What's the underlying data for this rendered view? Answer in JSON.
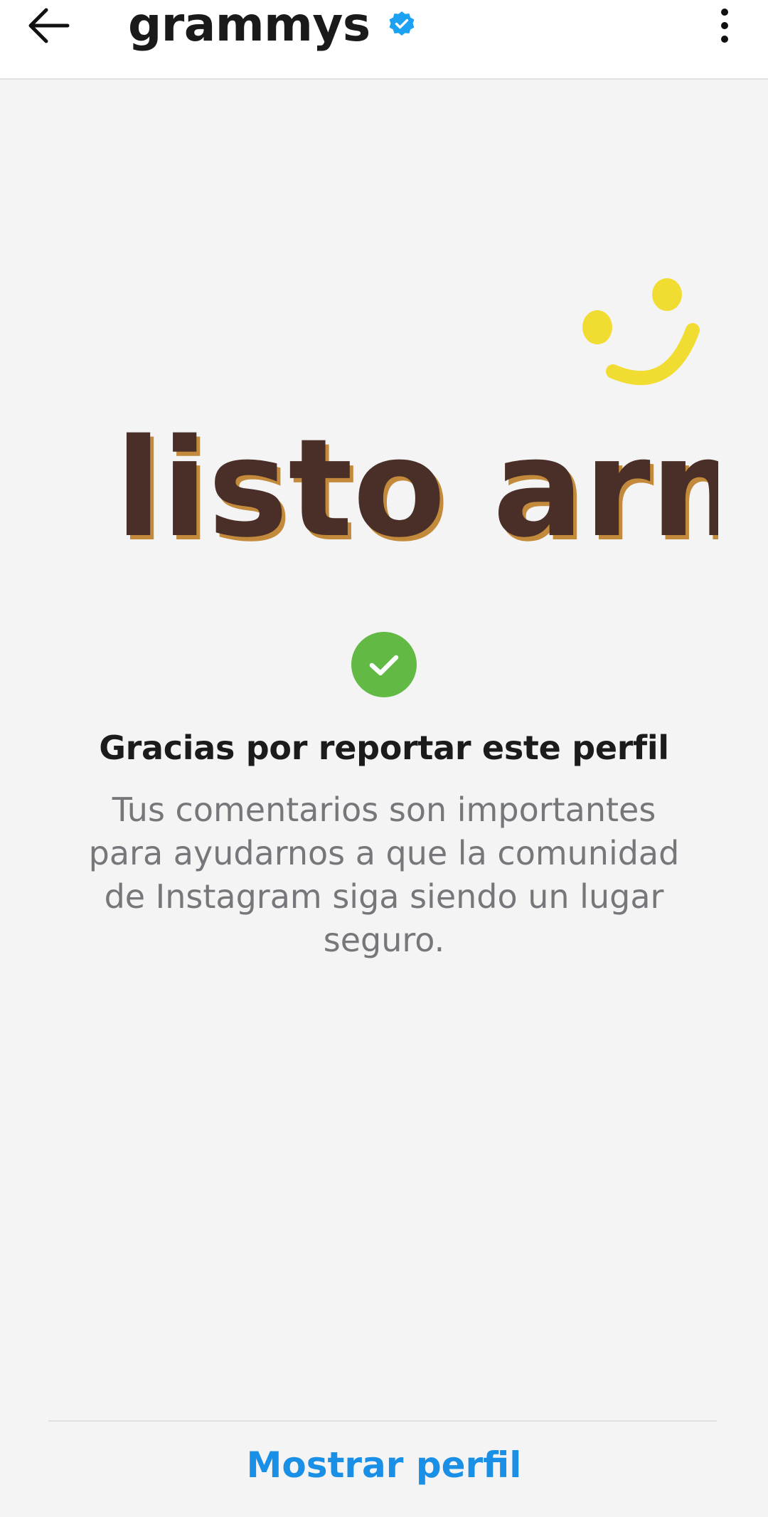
{
  "header": {
    "title": "grammys",
    "back_icon": "arrow-left-icon",
    "verified_icon": "verified-badge-icon",
    "more_icon": "more-vertical-icon"
  },
  "sticker": {
    "text": "listo army",
    "icon": "smiley-face-icon"
  },
  "confirmation": {
    "icon": "check-circle-icon",
    "heading": "Gracias por reportar este perfil",
    "body": "Tus comentarios son importantes para ayudarnos a que la comunidad de Instagram siga siendo un lugar seguro."
  },
  "footer": {
    "show_profile_label": "Mostrar perfil"
  },
  "colors": {
    "accent": "#1a8fe6",
    "check_green": "#62b944",
    "verified_blue": "#1da1f2",
    "sticker_brown": "#4a2f28",
    "sticker_yellow": "#f1dd32"
  }
}
